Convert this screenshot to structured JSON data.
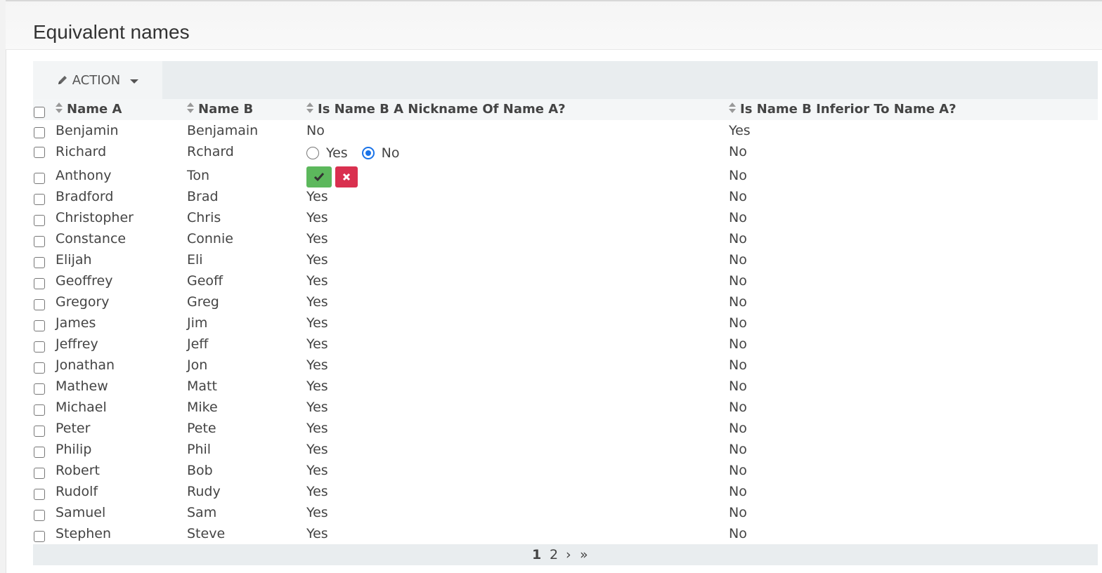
{
  "page": {
    "title": "Equivalent names"
  },
  "toolbar": {
    "action_label": "ACTION"
  },
  "table": {
    "columns": [
      "Name A",
      "Name B",
      "Is Name B A Nickname Of Name A?",
      "Is Name B Inferior To Name A?"
    ],
    "rows": [
      {
        "name_a": "Benjamin",
        "name_b": "Benjamain",
        "nickname": "No",
        "inferior": "Yes"
      },
      {
        "name_a": "Richard",
        "name_b": "Rchard",
        "nickname": "",
        "inferior": "No"
      },
      {
        "name_a": "Anthony",
        "name_b": "Ton",
        "nickname": "",
        "inferior": "No"
      },
      {
        "name_a": "Bradford",
        "name_b": "Brad",
        "nickname": "Yes",
        "inferior": "No"
      },
      {
        "name_a": "Christopher",
        "name_b": "Chris",
        "nickname": "Yes",
        "inferior": "No"
      },
      {
        "name_a": "Constance",
        "name_b": "Connie",
        "nickname": "Yes",
        "inferior": "No"
      },
      {
        "name_a": "Elijah",
        "name_b": "Eli",
        "nickname": "Yes",
        "inferior": "No"
      },
      {
        "name_a": "Geoffrey",
        "name_b": "Geoff",
        "nickname": "Yes",
        "inferior": "No"
      },
      {
        "name_a": "Gregory",
        "name_b": "Greg",
        "nickname": "Yes",
        "inferior": "No"
      },
      {
        "name_a": "James",
        "name_b": "Jim",
        "nickname": "Yes",
        "inferior": "No"
      },
      {
        "name_a": "Jeffrey",
        "name_b": "Jeff",
        "nickname": "Yes",
        "inferior": "No"
      },
      {
        "name_a": "Jonathan",
        "name_b": "Jon",
        "nickname": "Yes",
        "inferior": "No"
      },
      {
        "name_a": "Mathew",
        "name_b": "Matt",
        "nickname": "Yes",
        "inferior": "No"
      },
      {
        "name_a": "Michael",
        "name_b": "Mike",
        "nickname": "Yes",
        "inferior": "No"
      },
      {
        "name_a": "Peter",
        "name_b": "Pete",
        "nickname": "Yes",
        "inferior": "No"
      },
      {
        "name_a": "Philip",
        "name_b": "Phil",
        "nickname": "Yes",
        "inferior": "No"
      },
      {
        "name_a": "Robert",
        "name_b": "Bob",
        "nickname": "Yes",
        "inferior": "No"
      },
      {
        "name_a": "Rudolf",
        "name_b": "Rudy",
        "nickname": "Yes",
        "inferior": "No"
      },
      {
        "name_a": "Samuel",
        "name_b": "Sam",
        "nickname": "Yes",
        "inferior": "No"
      },
      {
        "name_a": "Stephen",
        "name_b": "Steve",
        "nickname": "Yes",
        "inferior": "No"
      }
    ]
  },
  "inline_edit": {
    "options": [
      "Yes",
      "No"
    ],
    "selected": "No"
  },
  "pagination": {
    "pages": [
      "1",
      "2"
    ],
    "current": "1",
    "next": "›",
    "last": "»"
  },
  "colors": {
    "confirm": "#5cb85c",
    "cancel": "#d9304f",
    "radio_selected": "#1a73e8"
  }
}
